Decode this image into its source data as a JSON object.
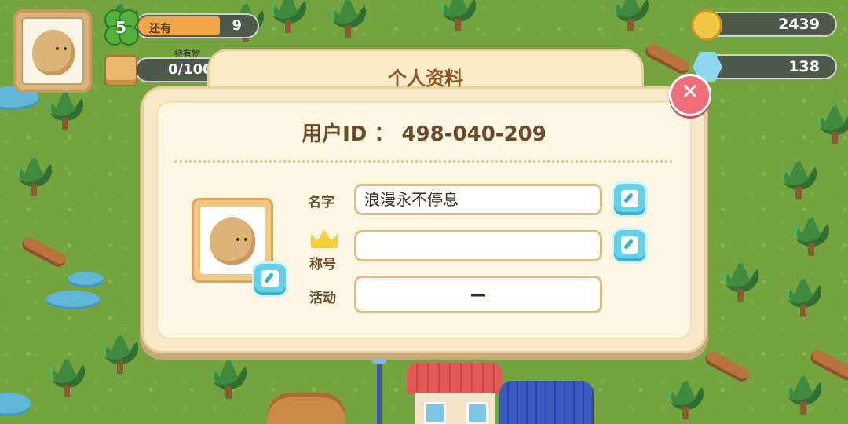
{
  "hud": {
    "level": "5",
    "life_label": "还有",
    "life_value": "9",
    "inventory_label": "持有物",
    "inventory_value": "0/100",
    "coins": "2439",
    "gems": "138"
  },
  "dialog": {
    "title": "个人资料",
    "user_id": "用户ID ： 498-040-209",
    "name_label": "名字",
    "name_value": "浪漫永不停息",
    "title_label": "称号",
    "title_value": "",
    "event_label": "活动",
    "event_value": "—",
    "close_glyph": "✕"
  },
  "colors": {
    "accent": "#f26d7a",
    "edit_button": "#63d2e6",
    "panel": "#fdf6e2"
  }
}
